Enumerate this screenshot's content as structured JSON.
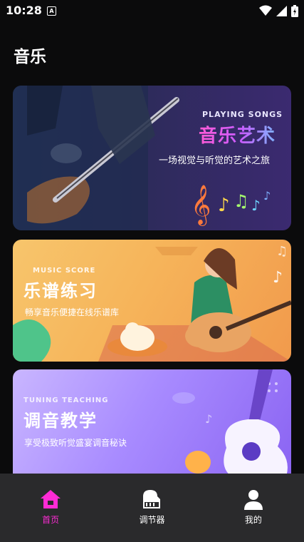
{
  "status_bar": {
    "time": "10:28",
    "notification_icon": "A"
  },
  "page": {
    "title": "音乐"
  },
  "cards": [
    {
      "subtitle": "PLAYING SONGS",
      "title": "音乐艺术",
      "description": "一场视觉与听觉的艺术之旅"
    },
    {
      "subtitle": "MUSIC SCORE",
      "title": "乐谱练习",
      "description": "畅享音乐便捷在线乐谱库"
    },
    {
      "subtitle": "TUNING TEACHING",
      "title": "调音教学",
      "description": "享受极致听觉盛宴调音秘诀"
    }
  ],
  "nav": [
    {
      "label": "首页",
      "icon": "home-icon",
      "active": true
    },
    {
      "label": "调节器",
      "icon": "piano-icon",
      "active": false
    },
    {
      "label": "我的",
      "icon": "user-icon",
      "active": false
    }
  ],
  "colors": {
    "accent": "#ff2bd6",
    "background": "#0b0b0c",
    "nav_bg": "#2a2a2c"
  }
}
